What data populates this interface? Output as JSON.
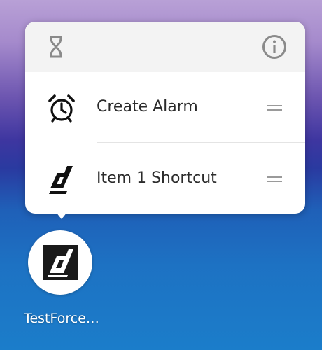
{
  "shortcut_menu": {
    "header": {
      "left_icon": "hourglass-icon",
      "right_icon": "info-icon"
    },
    "items": [
      {
        "label": "Create Alarm",
        "icon": "alarm-clock-icon"
      },
      {
        "label": "Item 1 Shortcut",
        "icon": "testforce-logo-icon"
      }
    ]
  },
  "app": {
    "label": "TestForce…",
    "icon": "testforce-logo-icon"
  },
  "colors": {
    "popup_background": "#ffffff",
    "popup_header": "#f3f3f3",
    "text": "#2b2b2b",
    "drag_handle": "#9a9a9a",
    "wallpaper_top": "#b8a0d6",
    "wallpaper_bottom": "#1b7dca"
  }
}
